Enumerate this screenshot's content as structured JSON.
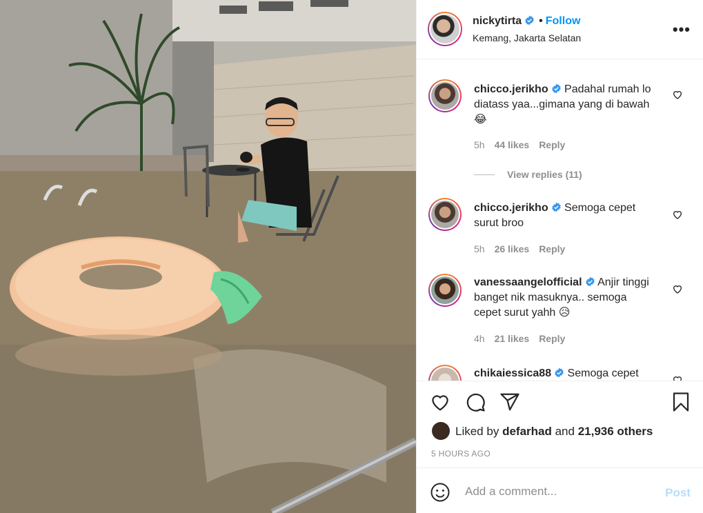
{
  "header": {
    "username": "nickytirta",
    "separator": "•",
    "follow_label": "Follow",
    "location": "Kemang, Jakarta Selatan",
    "more_label": "•••"
  },
  "comments": [
    {
      "username": "chicco.jerikho",
      "text": "Padahal rumah lo diatass yaa...gimana yang di bawah 😂",
      "time": "5h",
      "likes": "44 likes",
      "reply_label": "Reply",
      "view_replies": "View replies (11)"
    },
    {
      "username": "chicco.jerikho",
      "text": "Semoga cepet surut broo",
      "time": "5h",
      "likes": "26 likes",
      "reply_label": "Reply"
    },
    {
      "username": "vanessaangelofficial",
      "text": "Anjir tinggi banget nik masuknya.. semoga cepet surut yahh 😥",
      "time": "4h",
      "likes": "21 likes",
      "reply_label": "Reply"
    },
    {
      "username": "chikaiessica88",
      "text": "Semoga cepet"
    }
  ],
  "likes_bar": {
    "prefix": "Liked by",
    "liker": "defarhad",
    "conjunction": "and",
    "others": "21,936 others"
  },
  "timestamp": "5 HOURS AGO",
  "add_comment": {
    "placeholder": "Add a comment...",
    "post_label": "Post"
  },
  "colors": {
    "accent": "#0095f6",
    "verified": "#3897f0",
    "muted": "#8e8e8e",
    "post_disabled": "#b2dffc"
  },
  "icons": [
    "heart-icon",
    "comment-icon",
    "share-icon",
    "bookmark-icon",
    "emoji-icon",
    "verified-icon",
    "more-icon"
  ]
}
